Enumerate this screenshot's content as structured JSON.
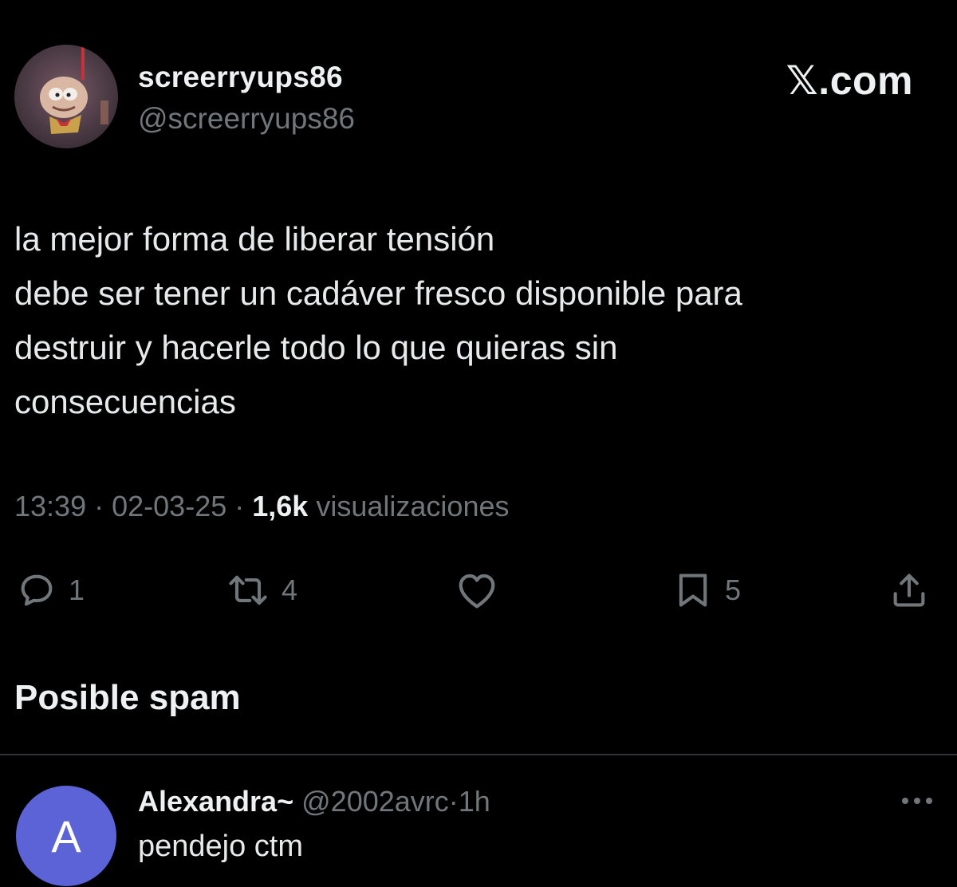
{
  "post": {
    "display_name": "screerryups86",
    "handle": "@screerryups86",
    "brand": "𝕏.com",
    "text_lines": [
      "la mejor forma de liberar tensión",
      "debe ser tener un cadáver fresco disponible para",
      "destruir y hacerle todo lo que quieras sin",
      "consecuencias"
    ],
    "time": "13:39",
    "date": "02-03-25",
    "views_count": "1,6k",
    "views_label": "visualizaciones",
    "separator": "·"
  },
  "actions": {
    "replies": "1",
    "reposts": "4",
    "likes": "",
    "bookmarks": "5"
  },
  "section": {
    "title": "Posible spam"
  },
  "reply": {
    "avatar_letter": "A",
    "name": "Alexandra~",
    "handle": "@2002avrc",
    "separator": "·",
    "age": "1h",
    "text": "pendejo ctm"
  },
  "icons": {
    "reply": "comment-icon",
    "repost": "repost-icon",
    "like": "heart-icon",
    "bookmark": "bookmark-icon",
    "share": "share-icon",
    "more": "more-dots-icon"
  },
  "colors": {
    "background": "#000000",
    "text": "#e7e9ea",
    "muted": "#71767b",
    "divider": "#2f3336",
    "reply_avatar": "#5c63d6"
  }
}
